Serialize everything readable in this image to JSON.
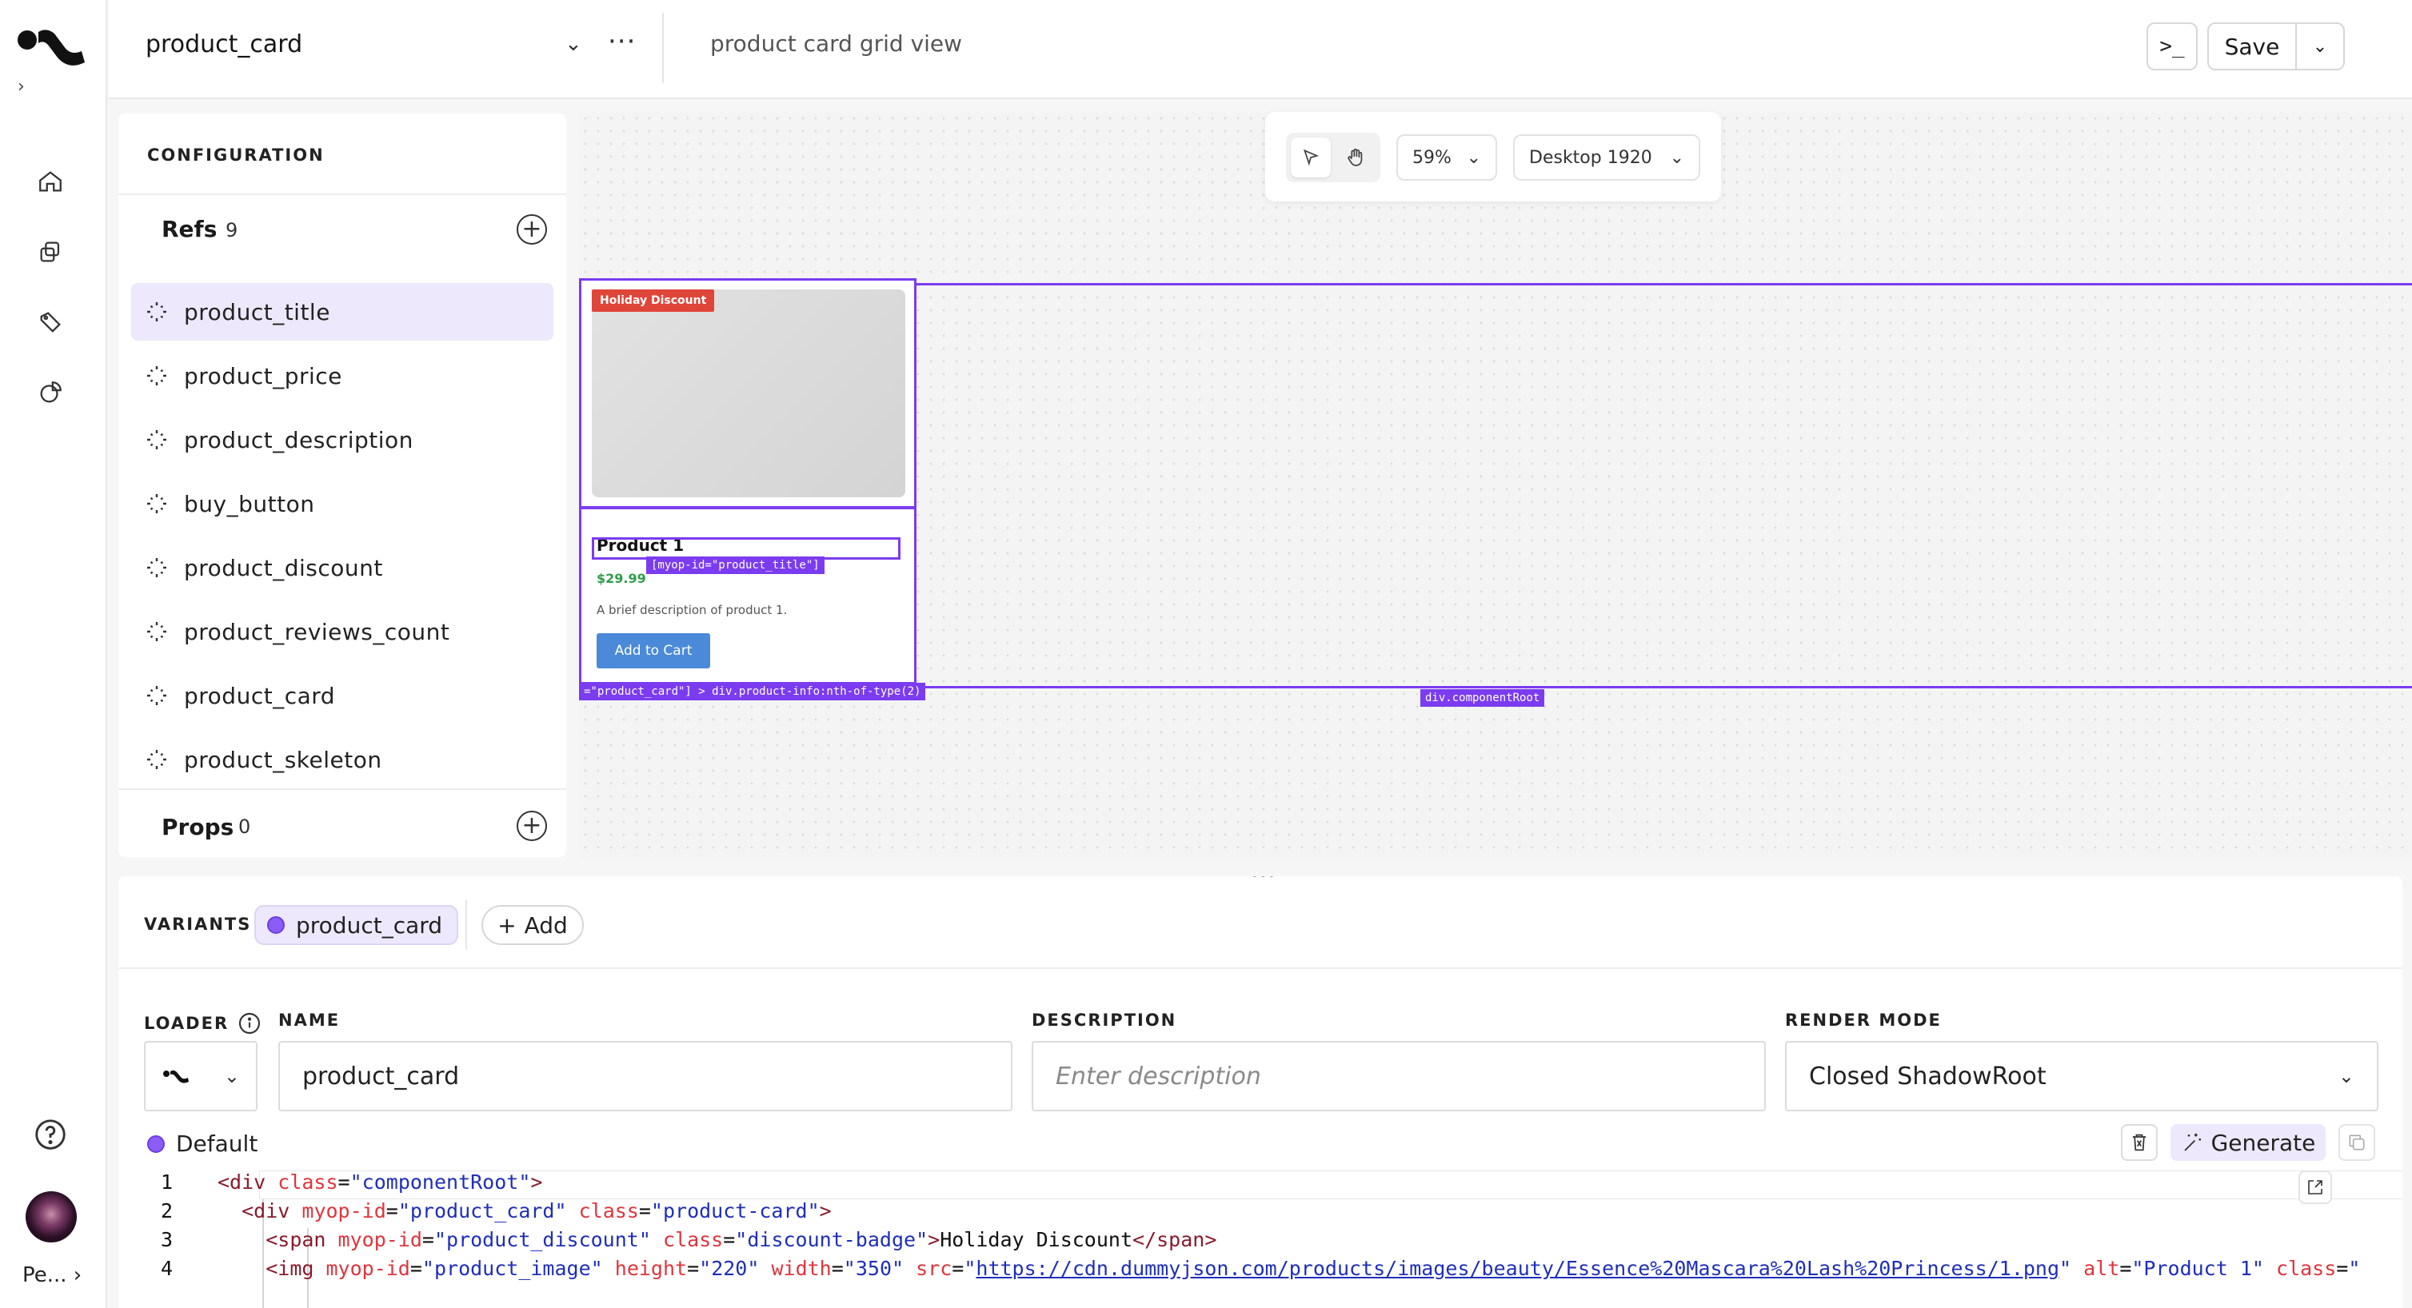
{
  "app": {
    "component_name": "product_card",
    "component_description": "product card grid view",
    "save_label": "Save",
    "user_label": "Pe..."
  },
  "config": {
    "heading": "CONFIGURATION",
    "refs_title": "Refs",
    "refs_count": "9",
    "refs": [
      "product_title",
      "product_price",
      "product_description",
      "buy_button",
      "product_discount",
      "product_reviews_count",
      "product_card",
      "product_skeleton"
    ],
    "props_title": "Props",
    "props_count": "0"
  },
  "canvas": {
    "zoom": "59%",
    "viewport": "Desktop 1920",
    "preview": {
      "discount": "Holiday Discount",
      "title": "Product 1",
      "price": "$29.99",
      "description": "A brief description of product 1.",
      "button": "Add to Cart",
      "tag_title": "[myop-id=\"product_title\"]",
      "tag_info": "=\"product_card\"] > div.product-info:nth-of-type(2)",
      "tag_root": "div.componentRoot"
    },
    "accent_color": "#7b3cf0"
  },
  "bottom": {
    "variants_label": "VARIANTS",
    "variant_chip": "product_card",
    "add_label": "Add",
    "loader_label": "LOADER",
    "name_label": "NAME",
    "name_value": "product_card",
    "description_label": "DESCRIPTION",
    "description_placeholder": "Enter description",
    "render_mode_label": "RENDER MODE",
    "render_mode_value": "Closed ShadowRoot",
    "default_label": "Default",
    "generate_label": "Generate"
  },
  "code": {
    "line_numbers": [
      "1",
      "2",
      "3",
      "4"
    ]
  },
  "colors": {
    "accent": "#7b3cf0",
    "chip_bg": "#ede8fb",
    "discount": "#e0453a",
    "price": "#2e9d4a",
    "button": "#4a8ad8"
  }
}
